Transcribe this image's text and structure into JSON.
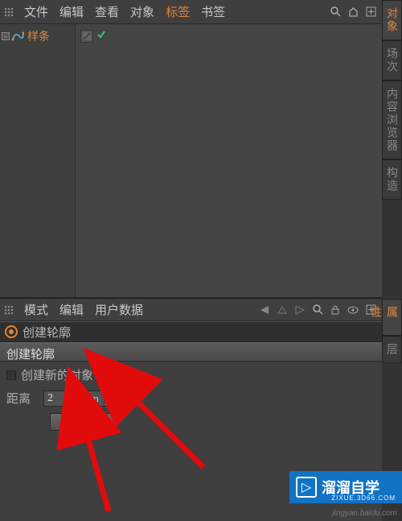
{
  "menubar": {
    "items": [
      "文件",
      "编辑",
      "查看",
      "对象",
      "标签",
      "书签"
    ],
    "active_index": 4,
    "icons": {
      "search": "search-icon",
      "home": "home-icon",
      "plus": "plus-icon"
    }
  },
  "side_tabs": {
    "upper": [
      {
        "label": "对象",
        "active": true
      },
      {
        "label": "场次",
        "active": false
      },
      {
        "label": "内容浏览器",
        "active": false
      },
      {
        "label": "构造",
        "active": false
      }
    ],
    "lower": [
      {
        "label": "属性",
        "active": true
      },
      {
        "label": "层",
        "active": false
      }
    ]
  },
  "objects": {
    "items": [
      {
        "name": "样条",
        "icon": "spline-icon"
      }
    ]
  },
  "attr_menubar": {
    "items": [
      "模式",
      "编辑",
      "用户数据"
    ],
    "icons": {
      "back": "nav-back-icon",
      "up": "nav-up-icon",
      "fwd": "nav-fwd-icon",
      "search": "search-icon",
      "lock": "lock-icon",
      "eye": "eye-icon",
      "plus": "plus-icon"
    }
  },
  "attr": {
    "title": "创建轮廓",
    "section": "创建轮廓",
    "create_new_label": "创建新的对象",
    "create_new_checked": false,
    "distance_label": "距离",
    "distance_value": "2",
    "distance_unit": "cm",
    "apply_label": "应用"
  },
  "watermark": {
    "brand": "溜溜自学",
    "domain": "ZIXUE.3D66.COM",
    "glyph": "▷"
  },
  "credit": "jingyan.baidu.com",
  "colors": {
    "accent": "#e0863a",
    "blue": "#1273c4"
  }
}
